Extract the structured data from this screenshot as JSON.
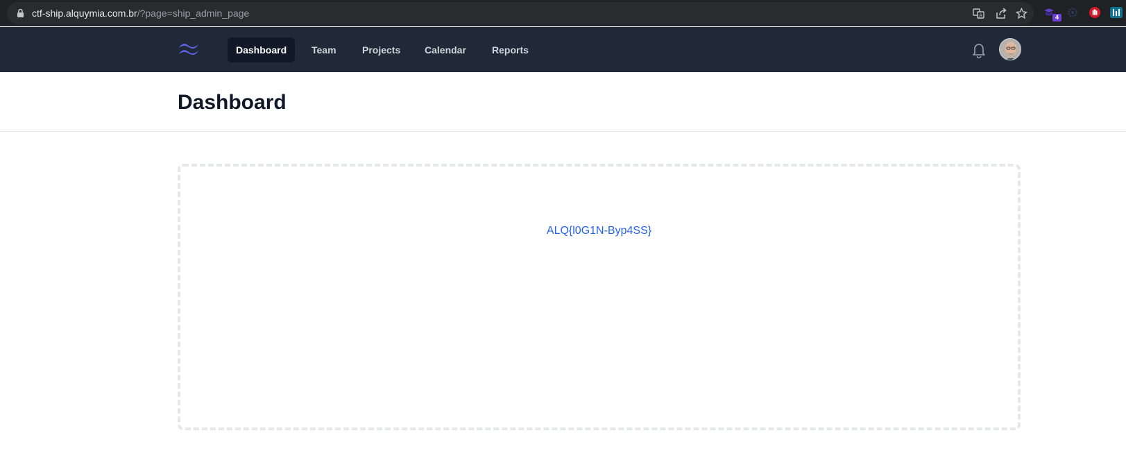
{
  "browser": {
    "url_host": "ctf-ship.alquymia.com.br",
    "url_path": "/?page=ship_admin_page",
    "extension_badge": "4"
  },
  "nav": {
    "items": [
      {
        "label": "Dashboard",
        "active": true
      },
      {
        "label": "Team",
        "active": false
      },
      {
        "label": "Projects",
        "active": false
      },
      {
        "label": "Calendar",
        "active": false
      },
      {
        "label": "Reports",
        "active": false
      }
    ]
  },
  "header": {
    "title": "Dashboard"
  },
  "main": {
    "content_text": "ALQ{l0G1N-Byp4SS}"
  },
  "colors": {
    "nav_bg": "#1f2937",
    "active_bg": "#111827",
    "link": "#2563eb",
    "logo": "#6366f1"
  }
}
